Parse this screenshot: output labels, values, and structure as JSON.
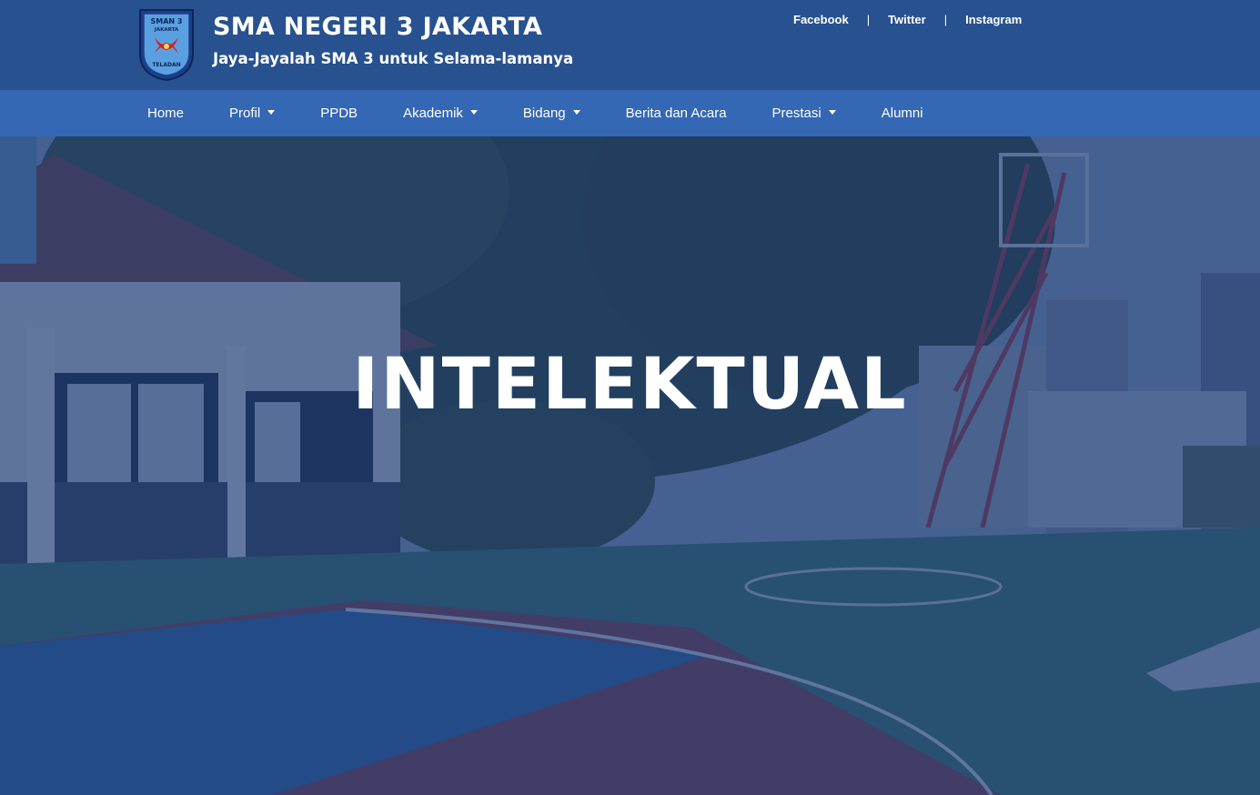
{
  "header": {
    "logo": {
      "top_text": "SMAN 3",
      "mid_text": "JAKARTA",
      "bottom_text": "TELADAN",
      "icon": "school-crest-icon"
    },
    "title": "SMA NEGERI 3 JAKARTA",
    "subtitle": "Jaya-Jayalah SMA 3 untuk Selama-lamanya",
    "social": {
      "facebook": "Facebook",
      "twitter": "Twitter",
      "instagram": "Instagram",
      "separator": "|"
    }
  },
  "nav": {
    "items": [
      {
        "label": "Home",
        "dropdown": false
      },
      {
        "label": "Profil",
        "dropdown": true
      },
      {
        "label": "PPDB",
        "dropdown": false
      },
      {
        "label": "Akademik",
        "dropdown": true
      },
      {
        "label": "Bidang",
        "dropdown": true
      },
      {
        "label": "Berita dan Acara",
        "dropdown": false
      },
      {
        "label": "Prestasi",
        "dropdown": true
      },
      {
        "label": "Alumni",
        "dropdown": false
      }
    ]
  },
  "hero": {
    "title": "INTELEKTUAL",
    "background": "school-basketball-court-photo"
  },
  "colors": {
    "header_bg": "#28518f",
    "nav_bg": "#3467b4",
    "hero_overlay": "#1e3c78"
  }
}
